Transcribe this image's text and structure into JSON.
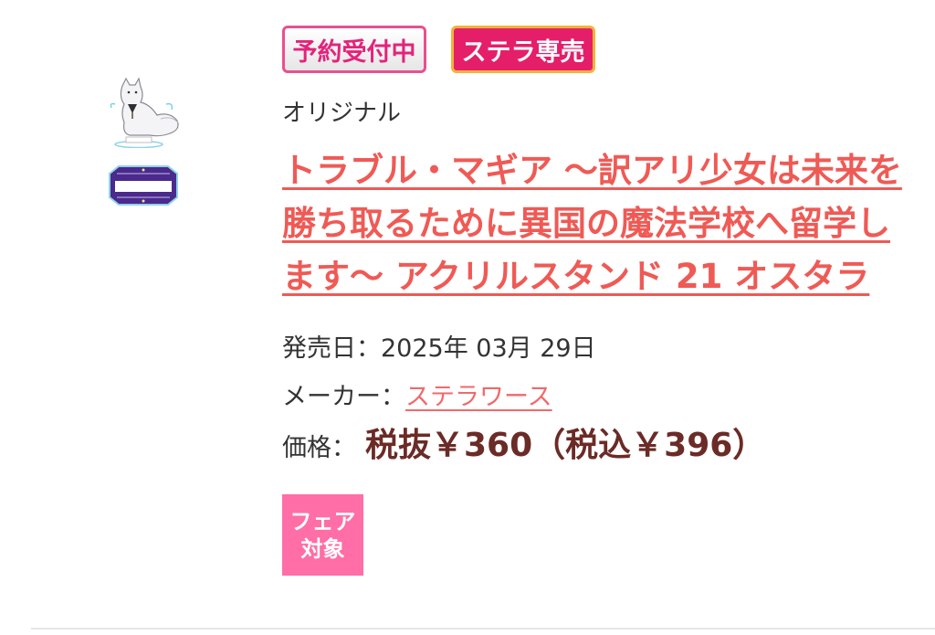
{
  "badges": {
    "reserve": "予約受付中",
    "stella_exclusive": "ステラ専売"
  },
  "product": {
    "series": "オリジナル",
    "title": "トラブル・マギア ～訳アリ少女は未来を勝ち取るために異国の魔法学校へ留学します～ アクリルスタンド 21 オスタラ",
    "release_label": "発売日：",
    "release_date": "2025年 03月 29日",
    "maker_label": "メーカー：",
    "maker": "ステラワース",
    "price_label": "価格：",
    "price": "税抜￥360（税込￥396）",
    "fair_tag_line1": "フェア",
    "fair_tag_line2": "対象"
  },
  "colors": {
    "title": "#ef5a55",
    "price": "#6b2b26",
    "fair_tag": "#ff6ea6",
    "badge_stella": "#e51e6a"
  }
}
